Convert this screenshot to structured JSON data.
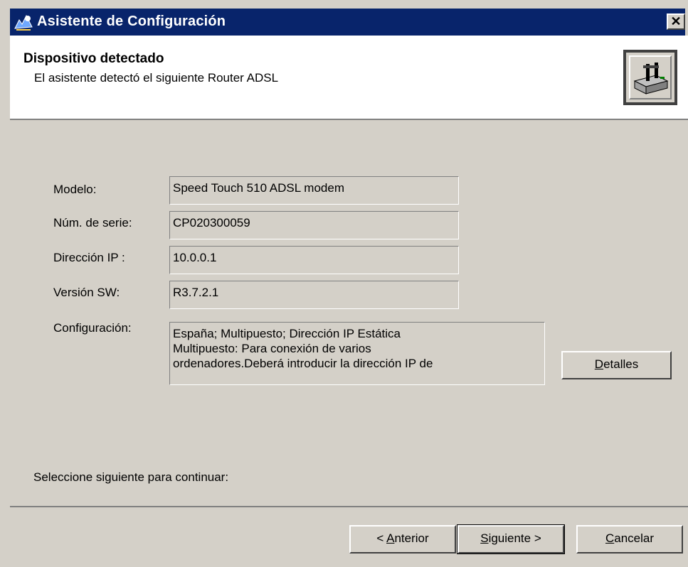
{
  "window": {
    "title": "Asistente de Configuración",
    "close_glyph": "✕"
  },
  "header": {
    "title": "Dispositivo detectado",
    "subtitle": "El asistente detectó el siguiente Router ADSL",
    "graphic_icon": "router-device-icon"
  },
  "fields": {
    "model": {
      "label": "Modelo:",
      "value": "Speed Touch 510 ADSL modem"
    },
    "serial": {
      "label": "Núm. de serie:",
      "value": "CP020300059"
    },
    "ip": {
      "label": "Dirección IP :",
      "value": "10.0.0.1"
    },
    "sw": {
      "label": "Versión SW:",
      "value": "R3.7.2.1"
    },
    "config": {
      "label": "Configuración:",
      "lines": [
        "España; Multipuesto; Dirección IP Estática",
        "Multipuesto: Para conexión de varios",
        "ordenadores.Deberá introducir la dirección IP de"
      ]
    }
  },
  "details_button": {
    "prefix": "",
    "underline": "D",
    "rest": "etalles"
  },
  "instruction": "Seleccione siguiente para continuar:",
  "buttons": {
    "back": {
      "prefix": "< ",
      "underline": "A",
      "rest": "nterior"
    },
    "next": {
      "prefix": "",
      "underline": "S",
      "rest": "iguiente >"
    },
    "cancel": {
      "prefix": "",
      "underline": "C",
      "rest": "ancelar"
    }
  },
  "colors": {
    "titlebar": "#08246b",
    "face": "#d4d0c8",
    "header_bg": "#ffffff"
  }
}
